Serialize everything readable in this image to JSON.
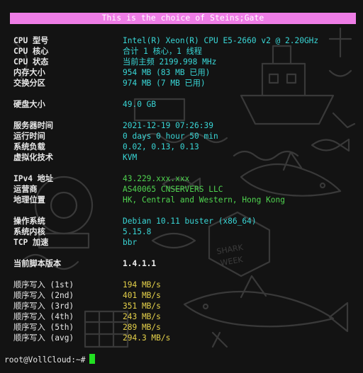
{
  "banner": "This is the choice of Steins;Gate",
  "system": [
    {
      "label": "CPU 型号",
      "value": "Intel(R) Xeon(R) CPU E5-2660 v2 @ 2.20GHz"
    },
    {
      "label": "CPU 核心",
      "value": "合计 1 核心，1 线程"
    },
    {
      "label": "CPU 状态",
      "value": "当前主频 2199.998 MHz"
    },
    {
      "label": "内存大小",
      "value": "954 MB (83 MB 已用)"
    },
    {
      "label": "交换分区",
      "value": "974 MB (7 MB 已用)"
    }
  ],
  "disk": {
    "label": "硬盘大小",
    "value": "49.0 GB"
  },
  "runtime": [
    {
      "label": "服务器时间",
      "value": "2021-12-19 07:26:39"
    },
    {
      "label": "运行时间",
      "value": "0 days 0 hour 50 min"
    },
    {
      "label": "系统负载",
      "value": "0.02, 0.13, 0.13"
    },
    {
      "label": "虚拟化技术",
      "value": "KVM"
    }
  ],
  "network": [
    {
      "label": "IPv4 地址",
      "value": "43.229.xxx.xxx"
    },
    {
      "label": "运营商",
      "value": "AS40065 CNSERVERS LLC"
    },
    {
      "label": "地理位置",
      "value": "HK, Central and Western, Hong Kong"
    }
  ],
  "os": [
    {
      "label": "操作系统",
      "value": "Debian 10.11 buster (x86_64)"
    },
    {
      "label": "系统内核",
      "value": "5.15.8"
    },
    {
      "label": "TCP 加速",
      "value": "bbr"
    }
  ],
  "script_version": {
    "label": "当前脚本版本",
    "value": "1.4.1.1"
  },
  "io_tests": [
    {
      "label": "顺序写入 (1st)",
      "value": "194 MB/s"
    },
    {
      "label": "顺序写入 (2nd)",
      "value": "401 MB/s"
    },
    {
      "label": "顺序写入 (3rd)",
      "value": "351 MB/s"
    },
    {
      "label": "顺序写入 (4th)",
      "value": "243 MB/s"
    },
    {
      "label": "顺序写入 (5th)",
      "value": "289 MB/s"
    },
    {
      "label": "顺序写入 (avg)",
      "value": "294.3 MB/s"
    }
  ],
  "prompt": "root@VollCloud:~#",
  "colors": {
    "banner_bg": "#ee7de6",
    "cyan": "#39d6d6",
    "green": "#4fd34f",
    "yellow": "#e5d14a",
    "cursor": "#22e022",
    "background": "#131313"
  }
}
